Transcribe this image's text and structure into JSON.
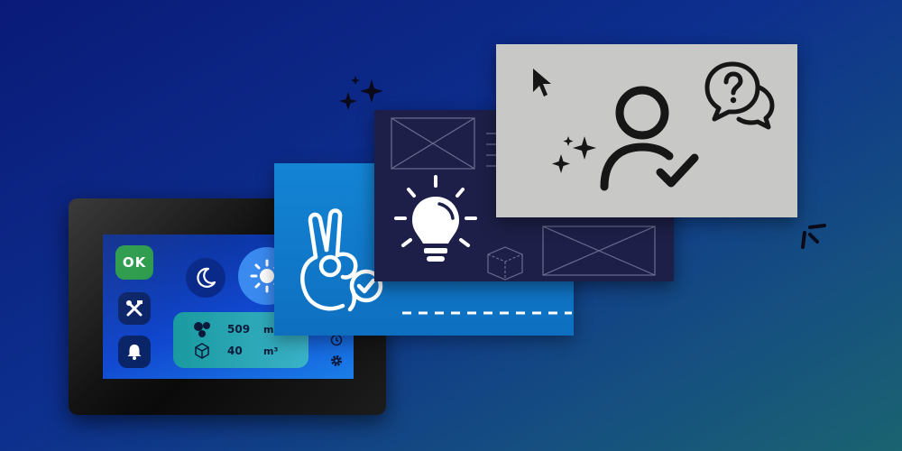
{
  "device": {
    "ok_label": "OK",
    "stats": [
      {
        "icon": "molecule-icon",
        "value": "509",
        "unit": "m"
      },
      {
        "icon": "cube-icon",
        "value": "40",
        "unit": "m³"
      }
    ]
  },
  "colors": {
    "background_start": "#0a1a78",
    "background_end": "#1a6370",
    "ok_green": "#2a9a4a",
    "card_blue": "#1484d4",
    "card_dark": "#1d1f48",
    "card_gray": "#c8c8c6"
  },
  "icons": [
    "sparkle-icon",
    "ok-hand-icon",
    "lightbulb-icon",
    "user-check-icon",
    "question-bubble-icon",
    "cursor-icon",
    "wireframe-image-icon",
    "box-3d-icon"
  ]
}
